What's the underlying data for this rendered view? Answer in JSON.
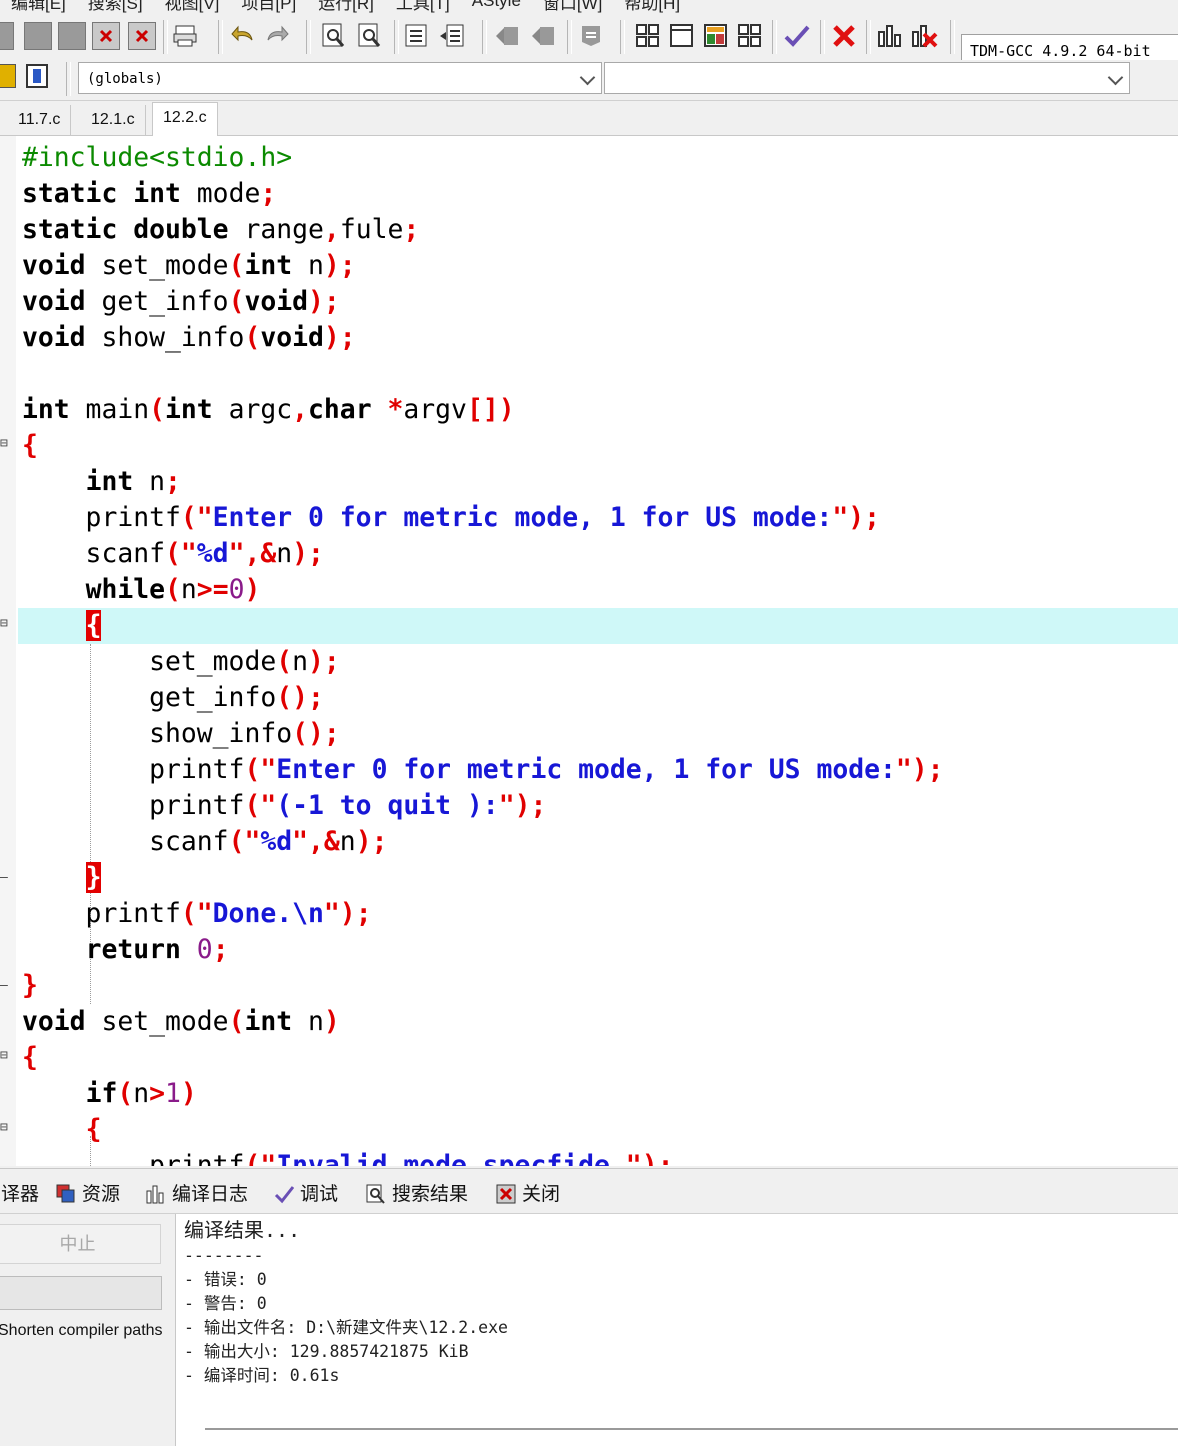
{
  "menu": [
    "编辑[E]",
    "搜索[S]",
    "视图[V]",
    "项目[P]",
    "运行[R]",
    "工具[T]",
    "AStyle",
    "窗口[W]",
    "帮助[H]"
  ],
  "toolbar": {
    "compiler": "TDM-GCC 4.9.2 64-bit",
    "scope": "(globals)",
    "function": ""
  },
  "tabs": [
    "11.7.c",
    "12.1.c",
    "12.2.c"
  ],
  "active_tab": "12.2.c",
  "code_lines": [
    "#include<stdio.h>",
    "static int mode;",
    "static double range,fule;",
    "void set_mode(int n);",
    "void get_info(void);",
    "void show_info(void);",
    "",
    "int main(int argc,char *argv[])",
    "{",
    "    int n;",
    "    printf(\"Enter 0 for metric mode, 1 for US mode:\");",
    "    scanf(\"%d\",&n);",
    "    while(n>=0)",
    "    {",
    "        set_mode(n);",
    "        get_info();",
    "        show_info();",
    "        printf(\"Enter 0 for metric mode, 1 for US mode:\");",
    "        printf(\"(-1 to quit ):\");",
    "        scanf(\"%d\",&n);",
    "    }",
    "    printf(\"Done.\\n\");",
    "    return 0;",
    "}",
    "void set_mode(int n)",
    "{",
    "    if(n>1)",
    "    {",
    "        printf(\"Invalid mode specfide.\");"
  ],
  "panel_tabs": [
    "编译器",
    "资源",
    "编译日志",
    "调试",
    "搜索结果",
    "关闭"
  ],
  "panel": {
    "abort": "中止",
    "shorten": "Shorten compiler paths",
    "log": [
      "编译结果...",
      "--------",
      "- 错误: 0",
      "- 警告: 0",
      "- 输出文件名: D:\\新建文件夹\\12.2.exe",
      "- 输出大小: 129.8857421875 KiB",
      "- 编译时间: 0.61s"
    ]
  },
  "colors": {
    "current_line": "#cff8f8",
    "keyword": "#000000",
    "preprocessor": "#0b8a00",
    "punctuation": "#e00000",
    "string": "#1717d6",
    "number": "#8a1b8a",
    "brace_match": "#e20000"
  }
}
